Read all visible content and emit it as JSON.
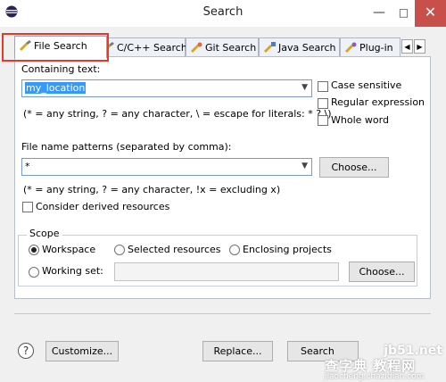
{
  "window": {
    "title": "Search",
    "minimize": "—",
    "maximize": "□",
    "close": "✕"
  },
  "tabs": [
    {
      "label": "File Search",
      "icon": "flashlight-icon",
      "active": true
    },
    {
      "label": "C/C++ Search",
      "icon": "flashlight-icon"
    },
    {
      "label": "Git Search",
      "icon": "git-search-icon"
    },
    {
      "label": "Java Search",
      "icon": "java-search-icon"
    },
    {
      "label": "Plug-in",
      "icon": "plugin-search-icon"
    }
  ],
  "tab_nav": {
    "prev": "◀",
    "next": "▶"
  },
  "containing_text": {
    "label": "Containing text:",
    "value": "my_location",
    "hint": "(* = any string, ? = any character, \\ = escape for literals: * ? \\)"
  },
  "options": {
    "case_sensitive": "Case sensitive",
    "regular_expression": "Regular expression",
    "whole_word": "Whole word"
  },
  "file_patterns": {
    "label": "File name patterns (separated by comma):",
    "value": "*",
    "choose": "Choose...",
    "hint": "(* = any string, ? = any character, !x = excluding x)"
  },
  "derived": {
    "label": "Consider derived resources"
  },
  "scope": {
    "label": "Scope",
    "workspace": "Workspace",
    "selected_resources": "Selected resources",
    "enclosing_projects": "Enclosing projects",
    "working_set": "Working set:",
    "working_set_value": "",
    "choose": "Choose..."
  },
  "footer": {
    "help": "?",
    "customize": "Customize...",
    "replace": "Replace...",
    "search": "Search"
  },
  "watermark": {
    "site": "jb51.net",
    "brand": "查字典 教程网",
    "url": "jiaocheng.chazidian.com"
  },
  "colors": {
    "highlight_border": "#e23b2e",
    "close_button": "#c7504a",
    "selection": "#3399ff"
  }
}
